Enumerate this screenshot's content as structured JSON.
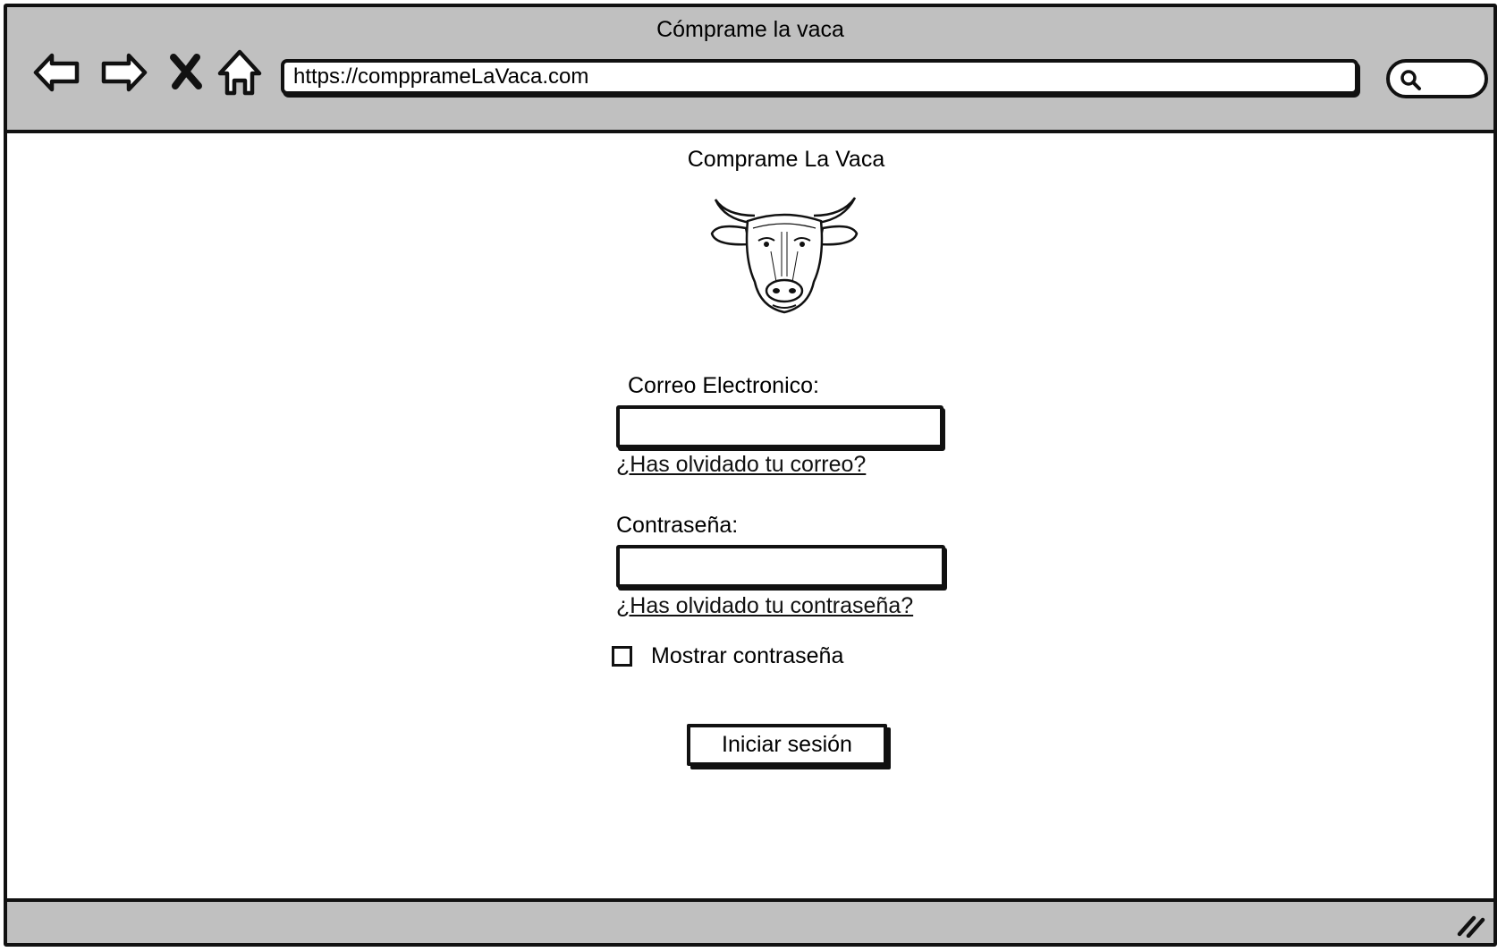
{
  "window": {
    "title": "Cómprame la vaca"
  },
  "toolbar": {
    "back_icon": "back-arrow-icon",
    "forward_icon": "forward-arrow-icon",
    "stop_icon": "close-x-icon",
    "home_icon": "home-icon",
    "url": "https://compprameLaVaca.com",
    "search_icon": "search-icon"
  },
  "page": {
    "title": "Comprame La Vaca",
    "logo_icon": "cow-head-icon"
  },
  "form": {
    "email_label": "Correo Electronico:",
    "email_value": "",
    "forgot_email_link": "¿Has olvidado tu correo?",
    "password_label": "Contraseña:",
    "password_value": "",
    "forgot_password_link": "¿Has olvidado tu contraseña?",
    "show_password_label": "Mostrar contraseña",
    "show_password_checked": false,
    "submit_label": "Iniciar sesión"
  },
  "statusbar": {
    "resize_icon": "resize-grip-icon"
  }
}
